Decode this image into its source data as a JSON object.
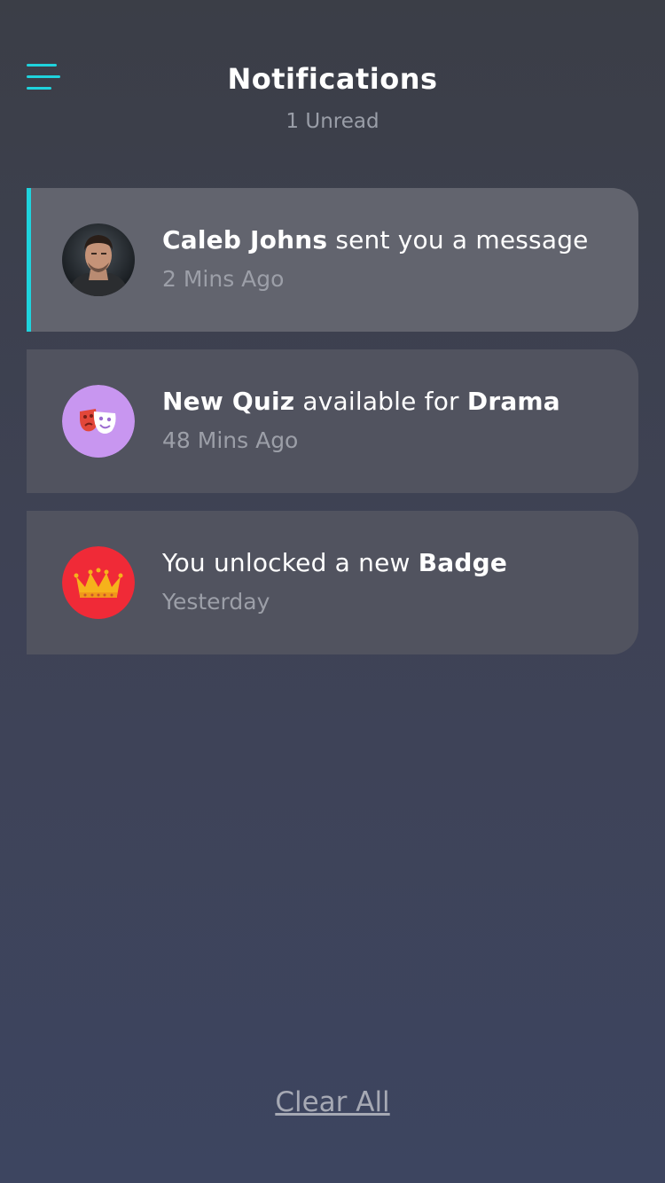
{
  "header": {
    "title": "Notifications",
    "subtitle": "1 Unread",
    "menu_icon": "hamburger-menu-icon",
    "accent_color": "#1fd3dd"
  },
  "notifications": [
    {
      "parts": [
        "Caleb Johns",
        " sent you a message"
      ],
      "time": "2 Mins Ago",
      "icon": "user-avatar",
      "unread": true
    },
    {
      "parts": [
        "New Quiz",
        " available for ",
        "Drama"
      ],
      "time": "48 Mins Ago",
      "icon": "theater-masks-icon",
      "icon_bg": "#c896f0",
      "unread": false
    },
    {
      "parts": [
        "You unlocked a new ",
        "Badge"
      ],
      "time": "Yesterday",
      "icon": "crown-icon",
      "icon_bg": "#f02a37",
      "unread": false
    }
  ],
  "footer": {
    "clear_all_label": "Clear All"
  }
}
